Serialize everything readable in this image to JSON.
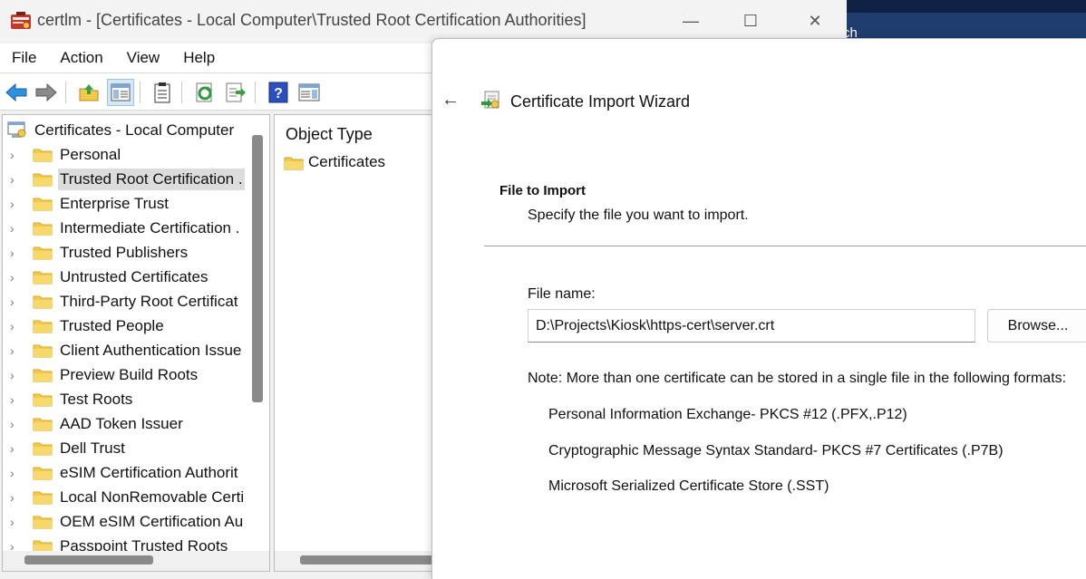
{
  "background_window": {
    "partial_text": "ch"
  },
  "mmc": {
    "title": "certlm - [Certificates - Local Computer\\Trusted Root Certification Authorities]",
    "window_buttons": {
      "minimize": "—",
      "maximize": "☐",
      "close": "✕"
    },
    "menu": [
      "File",
      "Action",
      "View",
      "Help"
    ],
    "toolbar_icons": [
      "back-arrow-icon",
      "forward-arrow-icon",
      "up-folder-icon",
      "show-hide-tree-icon",
      "properties-icon",
      "refresh-icon",
      "export-list-icon",
      "help-icon",
      "action-pane-icon"
    ],
    "tree": {
      "root": "Certificates - Local Computer",
      "items": [
        {
          "label": "Personal"
        },
        {
          "label": "Trusted Root Certification ."
        },
        {
          "label": "Enterprise Trust"
        },
        {
          "label": "Intermediate Certification ."
        },
        {
          "label": "Trusted Publishers"
        },
        {
          "label": "Untrusted Certificates"
        },
        {
          "label": "Third-Party Root Certificat"
        },
        {
          "label": "Trusted People"
        },
        {
          "label": "Client Authentication Issue"
        },
        {
          "label": "Preview Build Roots"
        },
        {
          "label": "Test Roots"
        },
        {
          "label": "AAD Token Issuer"
        },
        {
          "label": "Dell Trust"
        },
        {
          "label": "eSIM Certification Authorit"
        },
        {
          "label": "Local NonRemovable Certi"
        },
        {
          "label": "OEM eSIM Certification Au"
        },
        {
          "label": "Passpoint Trusted Roots"
        }
      ],
      "selected_index": 1,
      "chevron": "›"
    },
    "results": {
      "column_header": "Object Type",
      "items": [
        "Certificates"
      ]
    }
  },
  "wizard": {
    "back": "←",
    "title": "Certificate Import Wizard",
    "section_title": "File to Import",
    "section_subtitle": "Specify the file you want to import.",
    "file_label": "File name:",
    "file_value": "D:\\Projects\\Kiosk\\https-cert\\server.crt",
    "browse_label": "Browse...",
    "note": "Note:  More than one certificate can be stored in a single file in the following formats:",
    "formats": [
      "Personal Information Exchange- PKCS #12 (.PFX,.P12)",
      "Cryptographic Message Syntax Standard- PKCS #7 Certificates (.P7B)",
      "Microsoft Serialized Certificate Store (.SST)"
    ]
  },
  "colors": {
    "folder": "#f2c94c",
    "folder_dark": "#d9a92a",
    "selection": "#dcdcdc",
    "accent_blue": "#2f6fd6"
  }
}
